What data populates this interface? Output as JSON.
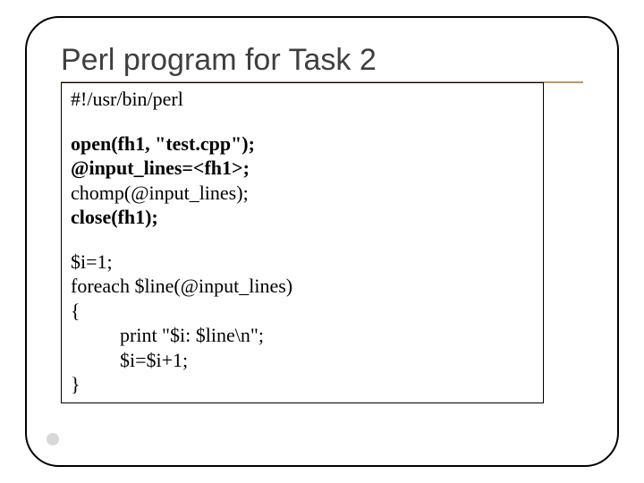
{
  "title": "Perl program for Task 2",
  "code": {
    "line1": "#!/usr/bin/perl",
    "line2": "open(fh1, \"test.cpp\");",
    "line3": "@input_lines=<fh1>;",
    "line4": "chomp(@input_lines);",
    "line5": "close(fh1);",
    "line6": "$i=1;",
    "line7": "foreach $line(@input_lines)",
    "line8": "{",
    "line9": "          print \"$i: $line\\n\";",
    "line10": "          $i=$i+1;",
    "line11": "}"
  }
}
